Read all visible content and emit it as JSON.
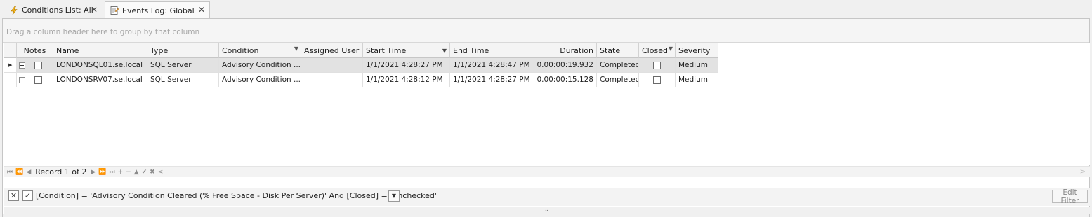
{
  "tabs": [
    {
      "label": "Conditions List: All",
      "icon": "lightning-icon",
      "active": false
    },
    {
      "label": "Events Log: Global",
      "icon": "log-icon",
      "active": true
    }
  ],
  "group_hint": "Drag a column header here to group by that column",
  "columns": {
    "notes": "Notes",
    "name": "Name",
    "type": "Type",
    "condition": "Condition",
    "assigned_user": "Assigned User",
    "start_time": "Start Time",
    "end_time": "End Time",
    "duration": "Duration",
    "state": "State",
    "closed": "Closed",
    "severity": "Severity"
  },
  "rows": [
    {
      "name": "LONDONSQL01.se.local",
      "type": "SQL Server",
      "condition": "Advisory Condition ...",
      "assigned_user": "",
      "start_time": "1/1/2021 4:28:27 PM",
      "end_time": "1/1/2021 4:28:47 PM",
      "duration": "0.00:00:19.932",
      "state": "Completed",
      "severity": "Medium"
    },
    {
      "name": "LONDONSRV07.se.local",
      "type": "SQL Server",
      "condition": "Advisory Condition ...",
      "assigned_user": "",
      "start_time": "1/1/2021 4:28:12 PM",
      "end_time": "1/1/2021 4:28:27 PM",
      "duration": "0.00:00:15.128",
      "state": "Completed",
      "severity": "Medium"
    }
  ],
  "navigator": {
    "record_text": "Record 1 of 2"
  },
  "filter": {
    "expression": "[Condition] = 'Advisory Condition Cleared (% Free Space - Disk Per Server)' And [Closed] = 'Unchecked'",
    "edit_label": "Edit Filter"
  }
}
